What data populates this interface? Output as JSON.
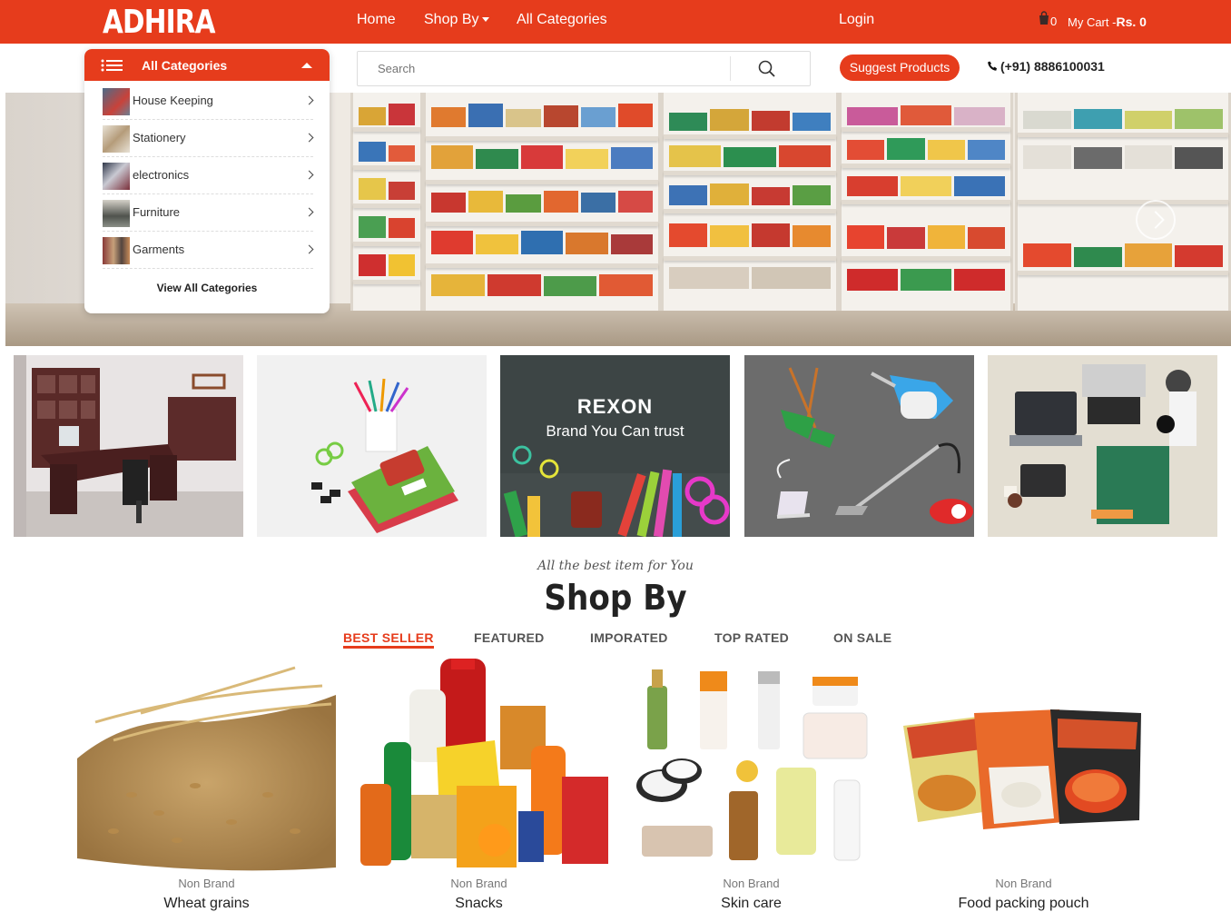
{
  "brand": {
    "logo": "ADHIRA",
    "accent_color": "#e63c1c"
  },
  "nav": {
    "home": "Home",
    "shop_by": "Shop By",
    "all_categories": "All Categories",
    "login": "Login"
  },
  "cart": {
    "count": "0",
    "label": "My Cart -",
    "total": "Rs. 0",
    "icon": "shopping-bag-icon"
  },
  "search": {
    "placeholder": "Search",
    "icon": "search-icon"
  },
  "suggest_label": "Suggest Products",
  "phone": {
    "number": "(+91) 8886100031",
    "icon": "phone-icon"
  },
  "category_menu": {
    "title": "All Categories",
    "items": [
      {
        "label": "House Keeping"
      },
      {
        "label": "Stationery"
      },
      {
        "label": "electronics"
      },
      {
        "label": "Furniture"
      },
      {
        "label": "Garments"
      }
    ],
    "view_all": "View All Categories"
  },
  "banners": {
    "rexon_title": "REXON",
    "rexon_sub": "Brand You Can trust"
  },
  "shop_by": {
    "tagline": "All the best item for You",
    "title": "Shop By",
    "tabs": [
      "BEST SELLER",
      "FEATURED",
      "IMPORATED",
      "TOP RATED",
      "ON SALE"
    ],
    "active_tab": "BEST SELLER"
  },
  "products": [
    {
      "brand": "Non Brand",
      "name": "Wheat grains"
    },
    {
      "brand": "Non Brand",
      "name": "Snacks"
    },
    {
      "brand": "Non Brand",
      "name": "Skin care"
    },
    {
      "brand": "Non Brand",
      "name": "Food packing pouch"
    }
  ]
}
